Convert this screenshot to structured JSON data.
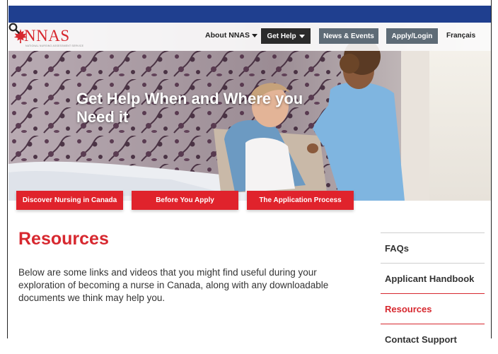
{
  "logo": {
    "text": "NNAS",
    "tagline": "NATIONAL NURSING ASSESSMENT SERVICE"
  },
  "nav": {
    "about": "About NNAS",
    "get_help": "Get Help",
    "news": "News & Events",
    "apply": "Apply/Login",
    "language": "Français",
    "search_icon": "search-icon"
  },
  "hero": {
    "title": "Get Help When and Where you Need it"
  },
  "cta": {
    "discover": "Discover Nursing in Canada",
    "before": "Before You Apply",
    "process": "The Application Process"
  },
  "main": {
    "title": "Resources",
    "body": "Below are some links and videos that you might find useful during your exploration of becoming a nurse in Canada, along with any downloadable documents we think may help you."
  },
  "sidebar": {
    "items": [
      {
        "label": "FAQs"
      },
      {
        "label": "Applicant Handbook"
      },
      {
        "label": "Resources"
      },
      {
        "label": "Contact Support"
      }
    ]
  },
  "colors": {
    "brand_red": "#d7282f",
    "topbar_blue": "#1f3f8f",
    "nav_dark": "#2b2b2b",
    "nav_gray": "#5e6b76"
  }
}
